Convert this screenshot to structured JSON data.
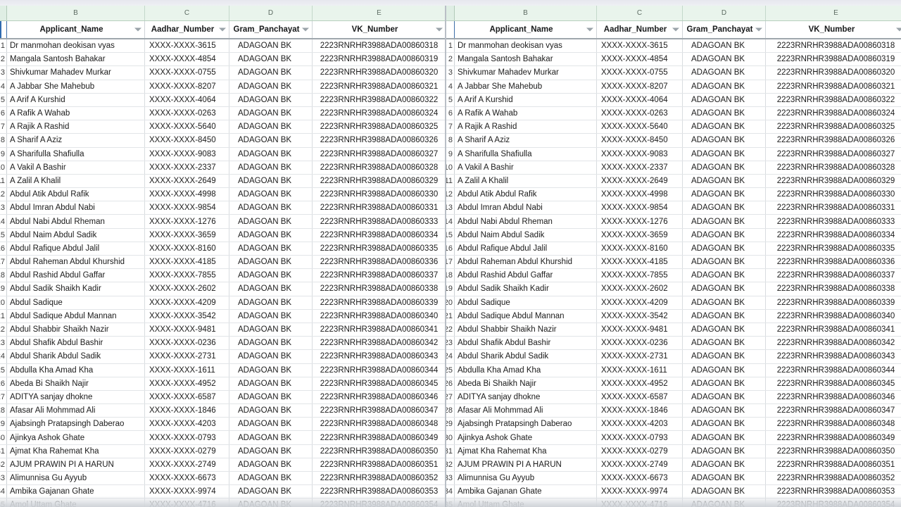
{
  "sheet": {
    "column_letters": [
      "B",
      "C",
      "D",
      "E"
    ],
    "headers": [
      "Applicant_Name",
      "Aadhar_Number",
      "Gram_Panchayat",
      "VK_Number"
    ],
    "filter_icon": "filter-dropdown-icon",
    "header_band_color": "#e9f4ec",
    "selection_border_color": "#2f6bb0",
    "rows": [
      {
        "n": "1",
        "name": "Dr manmohan deokisan vyas",
        "aadhar": "XXXX-XXXX-3615",
        "gram": "ADAGOAN BK",
        "vk": "2223RNRHR3988ADA00860318"
      },
      {
        "n": "2",
        "name": "Mangala Santosh Bahakar",
        "aadhar": "XXXX-XXXX-4854",
        "gram": "ADAGOAN BK",
        "vk": "2223RNRHR3988ADA00860319"
      },
      {
        "n": "3",
        "name": "Shivkumar Mahadev Murkar",
        "aadhar": "XXXX-XXXX-0755",
        "gram": "ADAGOAN BK",
        "vk": "2223RNRHR3988ADA00860320"
      },
      {
        "n": "4",
        "name": "A Jabbar She Mahebub",
        "aadhar": "XXXX-XXXX-8207",
        "gram": "ADAGOAN BK",
        "vk": "2223RNRHR3988ADA00860321"
      },
      {
        "n": "5",
        "name": "A Arif A  Kurshid",
        "aadhar": "XXXX-XXXX-4064",
        "gram": "ADAGOAN BK",
        "vk": "2223RNRHR3988ADA00860322"
      },
      {
        "n": "6",
        "name": "A Rafik A  Wahab",
        "aadhar": "XXXX-XXXX-0263",
        "gram": "ADAGOAN BK",
        "vk": "2223RNRHR3988ADA00860324"
      },
      {
        "n": "7",
        "name": "A Rajik A  Rashid",
        "aadhar": "XXXX-XXXX-5640",
        "gram": "ADAGOAN BK",
        "vk": "2223RNRHR3988ADA00860325"
      },
      {
        "n": "8",
        "name": "A Sharif A  Aziz",
        "aadhar": "XXXX-XXXX-8450",
        "gram": "ADAGOAN BK",
        "vk": "2223RNRHR3988ADA00860326"
      },
      {
        "n": "9",
        "name": "A Sharifulla Shafiulla",
        "aadhar": "XXXX-XXXX-9083",
        "gram": "ADAGOAN BK",
        "vk": "2223RNRHR3988ADA00860327"
      },
      {
        "n": "10",
        "name": "A Vakil A  Bashir",
        "aadhar": "XXXX-XXXX-2337",
        "gram": "ADAGOAN BK",
        "vk": "2223RNRHR3988ADA00860328"
      },
      {
        "n": "11",
        "name": "A Zalil A  Khalil",
        "aadhar": "XXXX-XXXX-2649",
        "gram": "ADAGOAN BK",
        "vk": "2223RNRHR3988ADA00860329"
      },
      {
        "n": "12",
        "name": "Abdul Atik Abdul Rafik",
        "aadhar": "XXXX-XXXX-4998",
        "gram": "ADAGOAN BK",
        "vk": "2223RNRHR3988ADA00860330"
      },
      {
        "n": "13",
        "name": "Abdul Imran Abdul Nabi",
        "aadhar": "XXXX-XXXX-9854",
        "gram": "ADAGOAN BK",
        "vk": "2223RNRHR3988ADA00860331"
      },
      {
        "n": "14",
        "name": "Abdul Nabi Abdul Rheman",
        "aadhar": "XXXX-XXXX-1276",
        "gram": "ADAGOAN BK",
        "vk": "2223RNRHR3988ADA00860333"
      },
      {
        "n": "15",
        "name": "Abdul Naim Abdul Sadik",
        "aadhar": "XXXX-XXXX-3659",
        "gram": "ADAGOAN BK",
        "vk": "2223RNRHR3988ADA00860334"
      },
      {
        "n": "16",
        "name": "Abdul Rafique Abdul Jalil",
        "aadhar": "XXXX-XXXX-8160",
        "gram": "ADAGOAN BK",
        "vk": "2223RNRHR3988ADA00860335"
      },
      {
        "n": "17",
        "name": "Abdul Raheman Abdul Khurshid",
        "aadhar": "XXXX-XXXX-4185",
        "gram": "ADAGOAN BK",
        "vk": "2223RNRHR3988ADA00860336"
      },
      {
        "n": "18",
        "name": "Abdul Rashid Abdul Gaffar",
        "aadhar": "XXXX-XXXX-7855",
        "gram": "ADAGOAN BK",
        "vk": "2223RNRHR3988ADA00860337"
      },
      {
        "n": "19",
        "name": "Abdul Sadik Shaikh Kadir",
        "aadhar": "XXXX-XXXX-2602",
        "gram": "ADAGOAN BK",
        "vk": "2223RNRHR3988ADA00860338"
      },
      {
        "n": "20",
        "name": "Abdul Sadique",
        "aadhar": "XXXX-XXXX-4209",
        "gram": "ADAGOAN BK",
        "vk": "2223RNRHR3988ADA00860339"
      },
      {
        "n": "21",
        "name": "Abdul Sadique Abdul Mannan",
        "aadhar": "XXXX-XXXX-3542",
        "gram": "ADAGOAN BK",
        "vk": "2223RNRHR3988ADA00860340"
      },
      {
        "n": "22",
        "name": "Abdul Shabbir Shaikh Nazir",
        "aadhar": "XXXX-XXXX-9481",
        "gram": "ADAGOAN BK",
        "vk": "2223RNRHR3988ADA00860341"
      },
      {
        "n": "23",
        "name": "Abdul Shafik Abdul Bashir",
        "aadhar": "XXXX-XXXX-0236",
        "gram": "ADAGOAN BK",
        "vk": "2223RNRHR3988ADA00860342"
      },
      {
        "n": "24",
        "name": "Abdul Sharik Abdul Sadik",
        "aadhar": "XXXX-XXXX-2731",
        "gram": "ADAGOAN BK",
        "vk": "2223RNRHR3988ADA00860343"
      },
      {
        "n": "25",
        "name": "Abdulla Kha Amad Kha",
        "aadhar": "XXXX-XXXX-1611",
        "gram": "ADAGOAN BK",
        "vk": "2223RNRHR3988ADA00860344"
      },
      {
        "n": "26",
        "name": "Abeda Bi Shaikh Najir",
        "aadhar": "XXXX-XXXX-4952",
        "gram": "ADAGOAN BK",
        "vk": "2223RNRHR3988ADA00860345"
      },
      {
        "n": "27",
        "name": "ADITYA sanjay dhokne",
        "aadhar": "XXXX-XXXX-6587",
        "gram": "ADAGOAN BK",
        "vk": "2223RNRHR3988ADA00860346"
      },
      {
        "n": "28",
        "name": "Afasar Ali Mohmmad Ali",
        "aadhar": "XXXX-XXXX-1846",
        "gram": "ADAGOAN BK",
        "vk": "2223RNRHR3988ADA00860347"
      },
      {
        "n": "29",
        "name": "Ajabsingh Pratapsingh Daberao",
        "aadhar": "XXXX-XXXX-4203",
        "gram": "ADAGOAN BK",
        "vk": "2223RNRHR3988ADA00860348"
      },
      {
        "n": "30",
        "name": "Ajinkya Ashok Ghate",
        "aadhar": "XXXX-XXXX-0793",
        "gram": "ADAGOAN BK",
        "vk": "2223RNRHR3988ADA00860349"
      },
      {
        "n": "31",
        "name": "Ajmat Kha Rahemat Kha",
        "aadhar": "XXXX-XXXX-0279",
        "gram": "ADAGOAN BK",
        "vk": "2223RNRHR3988ADA00860350"
      },
      {
        "n": "32",
        "name": "AJUM PRAWIN PI A HARUN",
        "aadhar": "XXXX-XXXX-2749",
        "gram": "ADAGOAN BK",
        "vk": "2223RNRHR3988ADA00860351"
      },
      {
        "n": "33",
        "name": "Alimunnisa Gu  Ayyub",
        "aadhar": "XXXX-XXXX-6673",
        "gram": "ADAGOAN BK",
        "vk": "2223RNRHR3988ADA00860352"
      },
      {
        "n": "34",
        "name": "Ambika Gajanan Ghate",
        "aadhar": "XXXX-XXXX-9974",
        "gram": "ADAGOAN BK",
        "vk": "2223RNRHR3988ADA00860353"
      },
      {
        "n": "35",
        "name": "Amol Uttam Ghate",
        "aadhar": "XXXX-XXXX-4716",
        "gram": "ADAGOAN BK",
        "vk": "2223RNRHR3988ADA00860354"
      }
    ]
  }
}
